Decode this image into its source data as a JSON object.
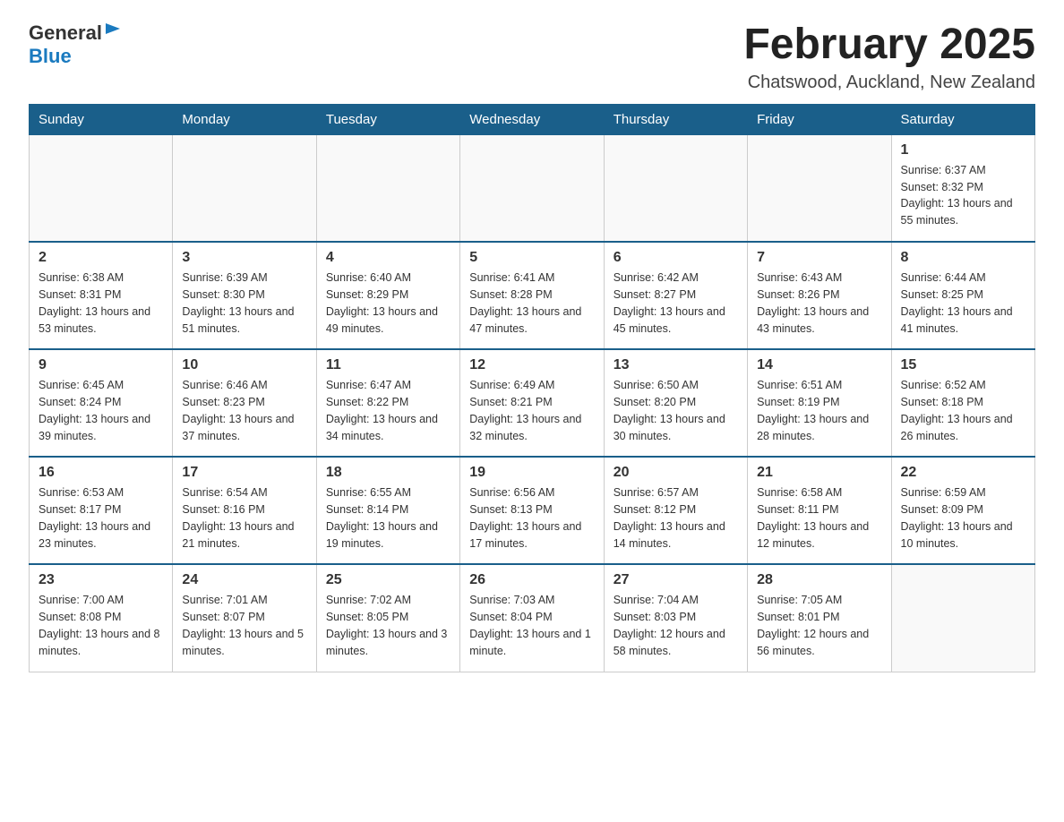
{
  "header": {
    "logo_general": "General",
    "logo_blue": "Blue",
    "month_title": "February 2025",
    "location": "Chatswood, Auckland, New Zealand"
  },
  "days_of_week": [
    "Sunday",
    "Monday",
    "Tuesday",
    "Wednesday",
    "Thursday",
    "Friday",
    "Saturday"
  ],
  "weeks": [
    [
      {
        "day": "",
        "info": ""
      },
      {
        "day": "",
        "info": ""
      },
      {
        "day": "",
        "info": ""
      },
      {
        "day": "",
        "info": ""
      },
      {
        "day": "",
        "info": ""
      },
      {
        "day": "",
        "info": ""
      },
      {
        "day": "1",
        "info": "Sunrise: 6:37 AM\nSunset: 8:32 PM\nDaylight: 13 hours and 55 minutes."
      }
    ],
    [
      {
        "day": "2",
        "info": "Sunrise: 6:38 AM\nSunset: 8:31 PM\nDaylight: 13 hours and 53 minutes."
      },
      {
        "day": "3",
        "info": "Sunrise: 6:39 AM\nSunset: 8:30 PM\nDaylight: 13 hours and 51 minutes."
      },
      {
        "day": "4",
        "info": "Sunrise: 6:40 AM\nSunset: 8:29 PM\nDaylight: 13 hours and 49 minutes."
      },
      {
        "day": "5",
        "info": "Sunrise: 6:41 AM\nSunset: 8:28 PM\nDaylight: 13 hours and 47 minutes."
      },
      {
        "day": "6",
        "info": "Sunrise: 6:42 AM\nSunset: 8:27 PM\nDaylight: 13 hours and 45 minutes."
      },
      {
        "day": "7",
        "info": "Sunrise: 6:43 AM\nSunset: 8:26 PM\nDaylight: 13 hours and 43 minutes."
      },
      {
        "day": "8",
        "info": "Sunrise: 6:44 AM\nSunset: 8:25 PM\nDaylight: 13 hours and 41 minutes."
      }
    ],
    [
      {
        "day": "9",
        "info": "Sunrise: 6:45 AM\nSunset: 8:24 PM\nDaylight: 13 hours and 39 minutes."
      },
      {
        "day": "10",
        "info": "Sunrise: 6:46 AM\nSunset: 8:23 PM\nDaylight: 13 hours and 37 minutes."
      },
      {
        "day": "11",
        "info": "Sunrise: 6:47 AM\nSunset: 8:22 PM\nDaylight: 13 hours and 34 minutes."
      },
      {
        "day": "12",
        "info": "Sunrise: 6:49 AM\nSunset: 8:21 PM\nDaylight: 13 hours and 32 minutes."
      },
      {
        "day": "13",
        "info": "Sunrise: 6:50 AM\nSunset: 8:20 PM\nDaylight: 13 hours and 30 minutes."
      },
      {
        "day": "14",
        "info": "Sunrise: 6:51 AM\nSunset: 8:19 PM\nDaylight: 13 hours and 28 minutes."
      },
      {
        "day": "15",
        "info": "Sunrise: 6:52 AM\nSunset: 8:18 PM\nDaylight: 13 hours and 26 minutes."
      }
    ],
    [
      {
        "day": "16",
        "info": "Sunrise: 6:53 AM\nSunset: 8:17 PM\nDaylight: 13 hours and 23 minutes."
      },
      {
        "day": "17",
        "info": "Sunrise: 6:54 AM\nSunset: 8:16 PM\nDaylight: 13 hours and 21 minutes."
      },
      {
        "day": "18",
        "info": "Sunrise: 6:55 AM\nSunset: 8:14 PM\nDaylight: 13 hours and 19 minutes."
      },
      {
        "day": "19",
        "info": "Sunrise: 6:56 AM\nSunset: 8:13 PM\nDaylight: 13 hours and 17 minutes."
      },
      {
        "day": "20",
        "info": "Sunrise: 6:57 AM\nSunset: 8:12 PM\nDaylight: 13 hours and 14 minutes."
      },
      {
        "day": "21",
        "info": "Sunrise: 6:58 AM\nSunset: 8:11 PM\nDaylight: 13 hours and 12 minutes."
      },
      {
        "day": "22",
        "info": "Sunrise: 6:59 AM\nSunset: 8:09 PM\nDaylight: 13 hours and 10 minutes."
      }
    ],
    [
      {
        "day": "23",
        "info": "Sunrise: 7:00 AM\nSunset: 8:08 PM\nDaylight: 13 hours and 8 minutes."
      },
      {
        "day": "24",
        "info": "Sunrise: 7:01 AM\nSunset: 8:07 PM\nDaylight: 13 hours and 5 minutes."
      },
      {
        "day": "25",
        "info": "Sunrise: 7:02 AM\nSunset: 8:05 PM\nDaylight: 13 hours and 3 minutes."
      },
      {
        "day": "26",
        "info": "Sunrise: 7:03 AM\nSunset: 8:04 PM\nDaylight: 13 hours and 1 minute."
      },
      {
        "day": "27",
        "info": "Sunrise: 7:04 AM\nSunset: 8:03 PM\nDaylight: 12 hours and 58 minutes."
      },
      {
        "day": "28",
        "info": "Sunrise: 7:05 AM\nSunset: 8:01 PM\nDaylight: 12 hours and 56 minutes."
      },
      {
        "day": "",
        "info": ""
      }
    ]
  ]
}
